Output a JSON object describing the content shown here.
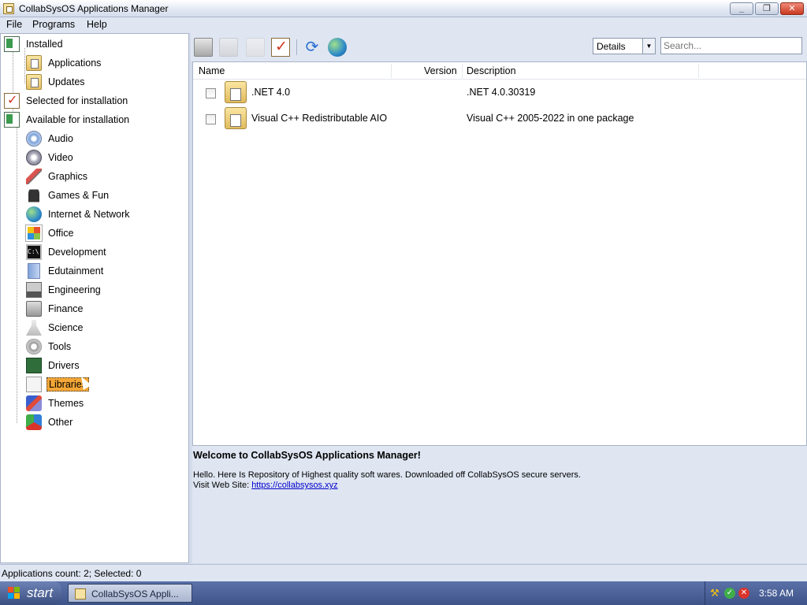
{
  "window": {
    "title": "CollabSysOS Applications Manager"
  },
  "menu": [
    "File",
    "Programs",
    "Help"
  ],
  "tree": {
    "installed": "Installed",
    "installed_children": [
      "Applications",
      "Updates"
    ],
    "selected_for_installation": "Selected for installation",
    "available": "Available for installation",
    "categories": [
      {
        "label": "Audio",
        "icon": "audio-cd-icon"
      },
      {
        "label": "Video",
        "icon": "video-dvd-icon"
      },
      {
        "label": "Graphics",
        "icon": "graphics-brush-icon"
      },
      {
        "label": "Games & Fun",
        "icon": "games-chess-icon"
      },
      {
        "label": "Internet & Network",
        "icon": "globe-icon"
      },
      {
        "label": "Office",
        "icon": "office-icon"
      },
      {
        "label": "Development",
        "icon": "console-icon"
      },
      {
        "label": "Edutainment",
        "icon": "book-icon"
      },
      {
        "label": "Engineering",
        "icon": "computer-icon"
      },
      {
        "label": "Finance",
        "icon": "calculator-icon"
      },
      {
        "label": "Science",
        "icon": "flask-icon"
      },
      {
        "label": "Tools",
        "icon": "gear-icon"
      },
      {
        "label": "Drivers",
        "icon": "circuit-board-icon"
      },
      {
        "label": "Libraries",
        "icon": "library-gear-icon",
        "selected": true
      },
      {
        "label": "Themes",
        "icon": "themes-icon"
      },
      {
        "label": "Other",
        "icon": "other-blocks-icon"
      }
    ]
  },
  "toolbar": {
    "view_mode": "Details",
    "search_placeholder": "Search..."
  },
  "list": {
    "columns": [
      "Name",
      "Version",
      "Description"
    ],
    "rows": [
      {
        "name": ".NET 4.0",
        "version": "",
        "description": ".NET 4.0.30319"
      },
      {
        "name": "Visual C++ Redistributable AIO",
        "version": "",
        "description": "Visual C++ 2005-2022 in one package"
      }
    ]
  },
  "info": {
    "heading": "Welcome to CollabSysOS Applications Manager!",
    "line1": "Hello. Here Is Repository of Highest quality soft wares. Downloaded off CollabSysOS secure servers.",
    "visit_label": "Visit Web Site: ",
    "url": "https://collabsysos.xyz"
  },
  "status": {
    "text": "Applications count: 2; Selected: 0"
  },
  "taskbar": {
    "start_label": "start",
    "task_label": "CollabSysOS Appli...",
    "clock": "3:58 AM"
  }
}
